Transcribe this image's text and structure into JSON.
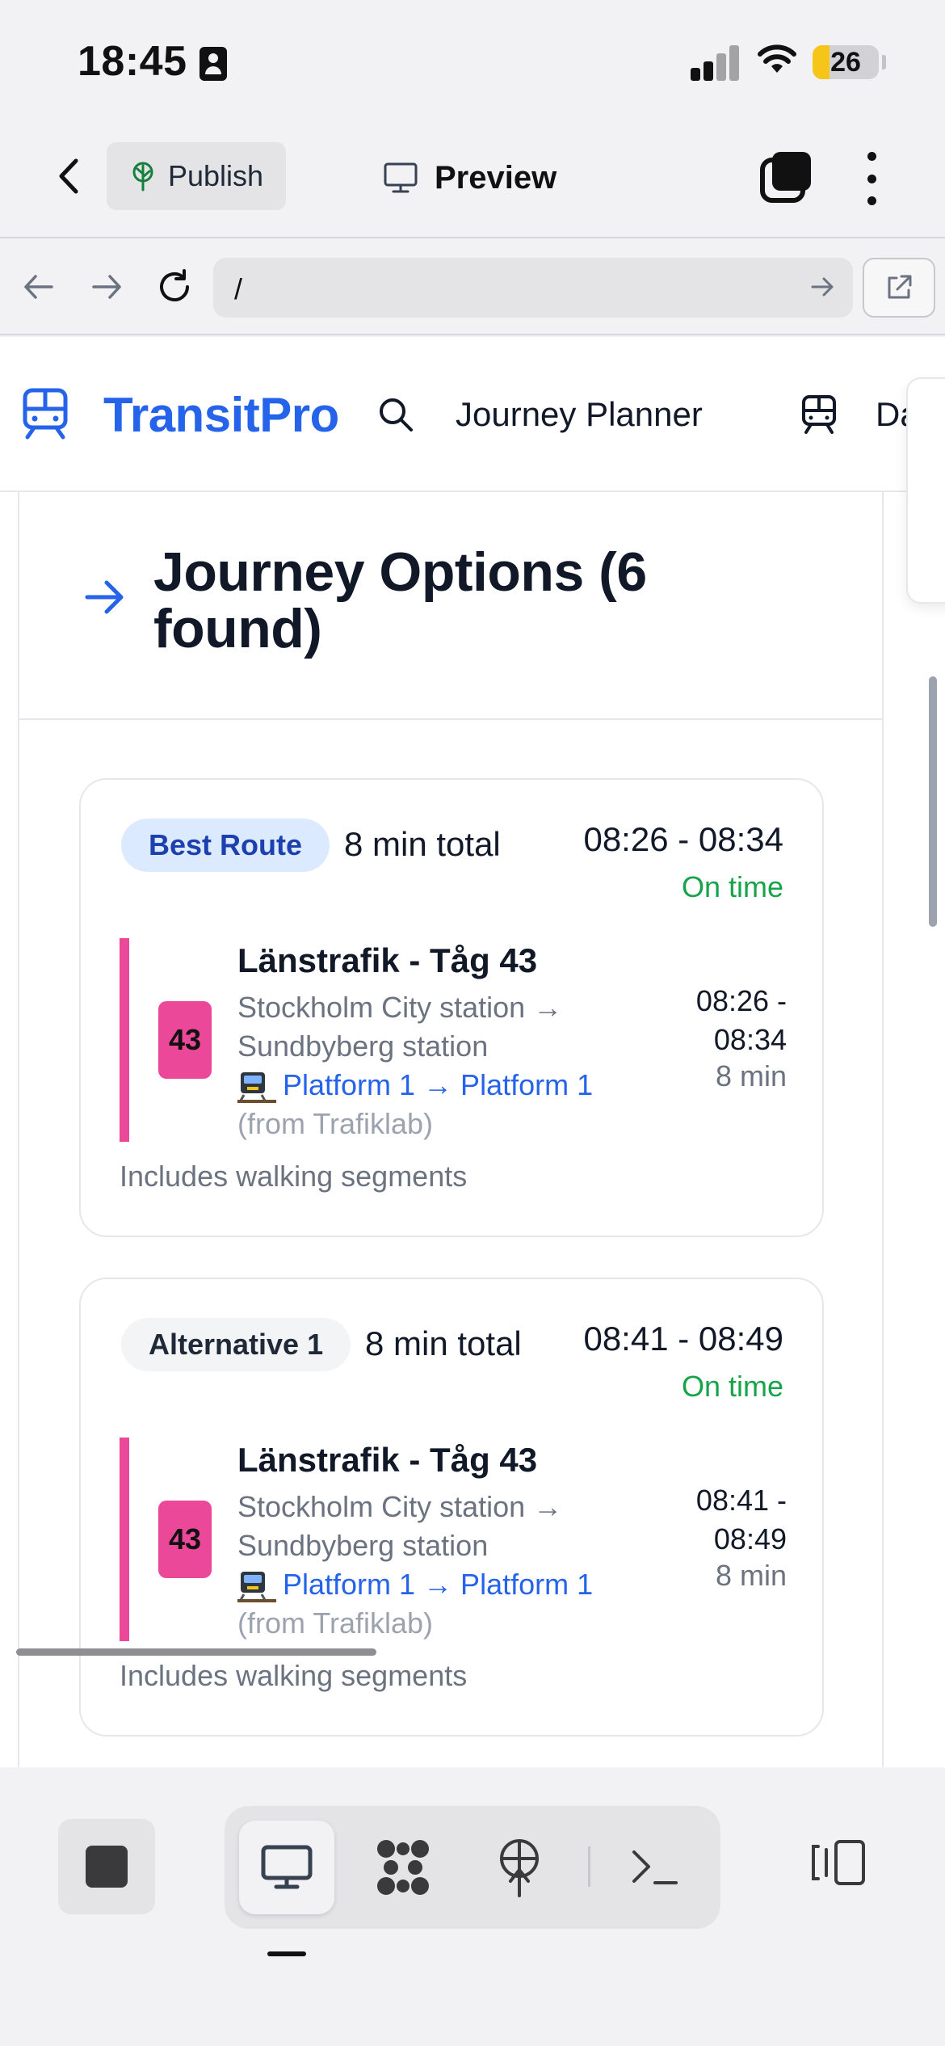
{
  "status_bar": {
    "time": "18:45",
    "battery": "26",
    "battery_level": 0.26
  },
  "toolbar": {
    "publish_label": "Publish",
    "preview_label": "Preview"
  },
  "browser": {
    "url": "/"
  },
  "site": {
    "brand": "TransitPro",
    "nav": [
      {
        "label": "Journey Planner"
      },
      {
        "label": "Daily"
      }
    ]
  },
  "panel": {
    "title": "Journey Options (6 found)"
  },
  "journeys": [
    {
      "badge": "Best Route",
      "badge_style": "best",
      "total": "8 min total",
      "times": "08:26 - 08:34",
      "status": "On time",
      "leg": {
        "line": "43",
        "line_color": "#ec4899",
        "title": "Länstrafik - Tåg 43",
        "stations": "Stockholm City station → Sundbyberg station",
        "platform": "Platform 1 → Platform 1",
        "source": "(from Trafiklab)",
        "times": "08:26 - 08:34",
        "duration": "8 min"
      },
      "note": "Includes walking segments"
    },
    {
      "badge": "Alternative 1",
      "badge_style": "alt",
      "total": "8 min total",
      "times": "08:41 - 08:49",
      "status": "On time",
      "leg": {
        "line": "43",
        "line_color": "#ec4899",
        "title": "Länstrafik - Tåg 43",
        "stations": "Stockholm City station → Sundbyberg station",
        "platform": "Platform 1 → Platform 1",
        "source": "(from Trafiklab)",
        "times": "08:41 - 08:49",
        "duration": "8 min"
      },
      "note": "Includes walking segments"
    }
  ],
  "icons": {
    "back": "chevron-left-icon",
    "publish": "tree-icon",
    "preview": "monitor-icon",
    "tabs": "tabs-icon",
    "menu": "kebab-icon",
    "nav_back": "arrow-left-icon",
    "nav_forward": "arrow-right-icon",
    "reload": "reload-icon",
    "open_external": "external-link-icon",
    "brand": "train-icon",
    "search": "search-icon",
    "stop": "stop-icon",
    "desktop": "monitor-icon",
    "apps": "apps-icon",
    "deploy": "antenna-icon",
    "console": "terminal-icon",
    "panel": "side-panel-icon"
  }
}
